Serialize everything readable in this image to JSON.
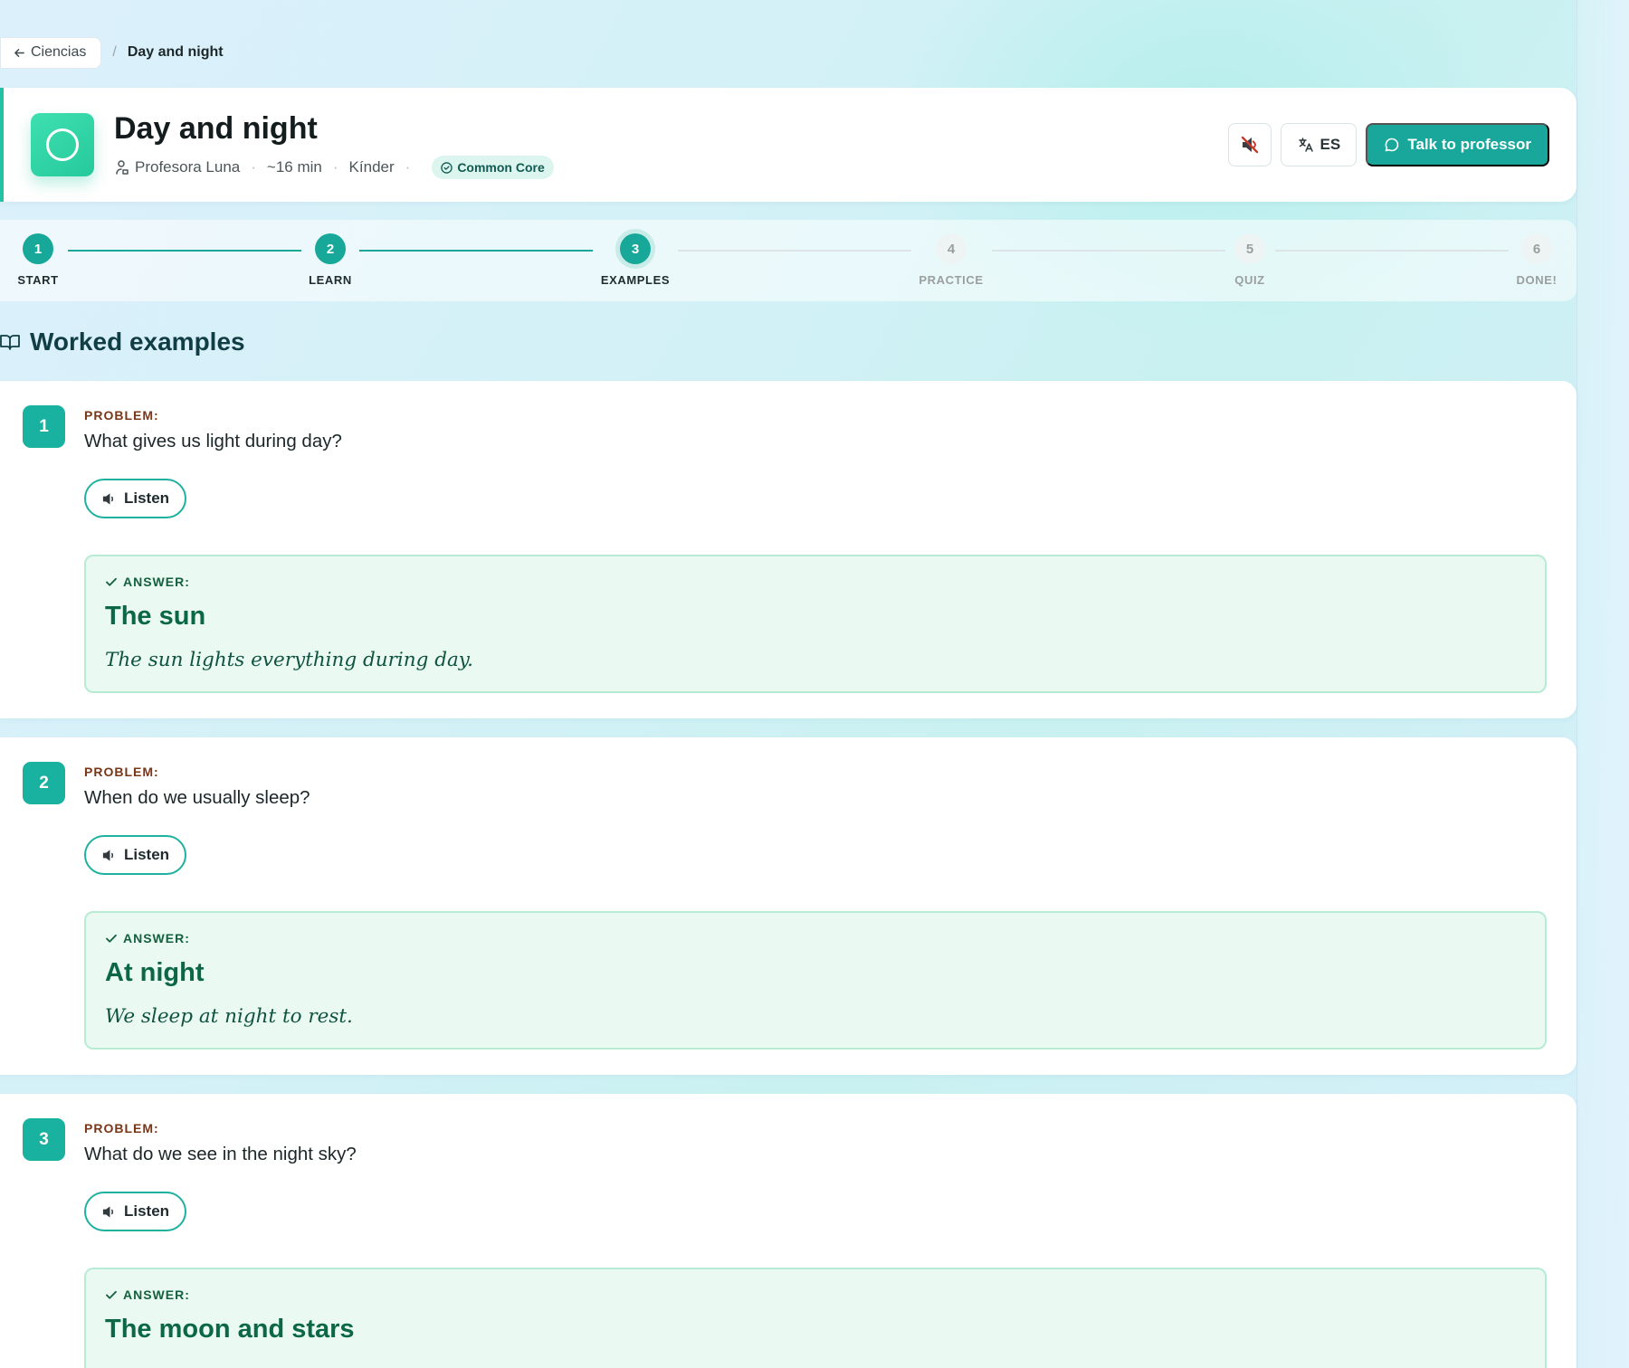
{
  "breadcrumb": {
    "back_label": "Ciencias",
    "separator": "/",
    "current": "Day and night"
  },
  "lesson": {
    "title": "Day and night",
    "teacher": "Profesora Luna",
    "duration": "~16 min",
    "level": "Kínder",
    "standard_badge": "Common Core",
    "accent_color": "#23c2a2"
  },
  "header_actions": {
    "mute_icon": "speaker-muted-icon",
    "language": "ES",
    "talk_label": "Talk to professor"
  },
  "progress": {
    "steps": [
      {
        "num": "1",
        "label": "START",
        "state": "done"
      },
      {
        "num": "2",
        "label": "LEARN",
        "state": "done"
      },
      {
        "num": "3",
        "label": "EXAMPLES",
        "state": "active"
      },
      {
        "num": "4",
        "label": "PRACTICE",
        "state": "future"
      },
      {
        "num": "5",
        "label": "QUIZ",
        "state": "future"
      },
      {
        "num": "6",
        "label": "DONE!",
        "state": "future"
      }
    ]
  },
  "section": {
    "title": "Worked examples",
    "icon": "open-book-icon"
  },
  "examples": [
    {
      "num": "1",
      "problem_label": "PROBLEM:",
      "problem": "What gives us light during day?",
      "listen_label": "Listen",
      "answer_label": "ANSWER:",
      "answer": "The sun",
      "explanation": "The sun lights everything during day."
    },
    {
      "num": "2",
      "problem_label": "PROBLEM:",
      "problem": "When do we usually sleep?",
      "listen_label": "Listen",
      "answer_label": "ANSWER:",
      "answer": "At night",
      "explanation": "We sleep at night to rest."
    },
    {
      "num": "3",
      "problem_label": "PROBLEM:",
      "problem": "What do we see in the night sky?",
      "listen_label": "Listen",
      "answer_label": "ANSWER:",
      "answer": "The moon and stars",
      "explanation": ""
    }
  ],
  "colors": {
    "primary": "#18a79a",
    "problem_label": "#7a3718",
    "answer_text": "#0c6748",
    "answer_bg": "#eafaf2"
  }
}
